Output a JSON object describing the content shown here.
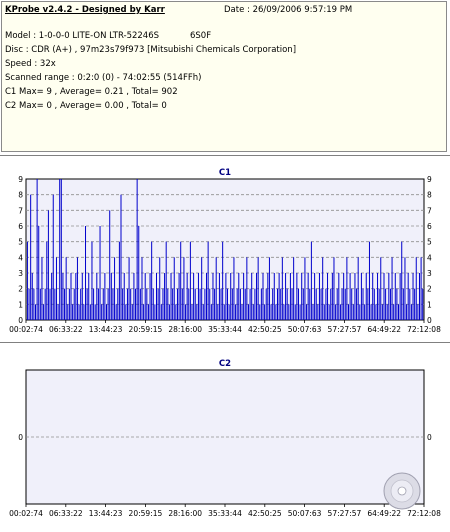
{
  "info": {
    "title": "KProbe v2.4.2 - Designed by Karr",
    "date": "Date : 26/09/2006 9:57:19 PM",
    "model": "Model : 1-0-0-0 LITE-ON LTR-52246S",
    "firmware": "6S0F",
    "disc": "Disc : CDR (A+) , 97m23s79f973 [Mitsubishi Chemicals Corporation]",
    "speed": "Speed : 32x",
    "range": "Scanned range : 0:2:0 (0) - 74:02:55 (514FFh)",
    "c1": "C1 Max= 9 , Average= 0.21 , Total= 902",
    "c2": "C2 Max= 0 , Average= 0.00 , Total= 0"
  },
  "chart_data": [
    {
      "type": "bar",
      "title": "C1",
      "ylim": [
        0,
        9
      ],
      "yticks": [
        "0",
        "1",
        "2",
        "3",
        "4",
        "5",
        "6",
        "7",
        "8",
        "9"
      ],
      "xticks": [
        "00:02:74",
        "06:33:22",
        "13:44:23",
        "20:59:15",
        "28:16:00",
        "35:33:44",
        "42:50:25",
        "50:07:63",
        "57:27:57",
        "64:49:22",
        "72:12:08"
      ],
      "xlim_minutes": [
        0.033,
        74.04
      ],
      "grid": true,
      "color": "#0000cc",
      "spikes": [
        [
          0.3,
          5
        ],
        [
          0.6,
          2
        ],
        [
          0.9,
          8
        ],
        [
          1.2,
          3
        ],
        [
          1.5,
          2
        ],
        [
          1.8,
          1
        ],
        [
          2.1,
          9
        ],
        [
          2.4,
          6
        ],
        [
          2.7,
          2
        ],
        [
          3.0,
          4
        ],
        [
          3.3,
          1
        ],
        [
          3.6,
          2
        ],
        [
          3.9,
          5
        ],
        [
          4.2,
          7
        ],
        [
          4.5,
          2
        ],
        [
          4.8,
          3
        ],
        [
          5.1,
          8
        ],
        [
          5.4,
          2
        ],
        [
          5.7,
          4
        ],
        [
          6.0,
          1
        ],
        [
          6.3,
          9
        ],
        [
          6.6,
          9
        ],
        [
          6.9,
          3
        ],
        [
          7.2,
          2
        ],
        [
          7.5,
          4
        ],
        [
          7.8,
          1
        ],
        [
          8.1,
          2
        ],
        [
          8.4,
          3
        ],
        [
          8.7,
          1
        ],
        [
          9.0,
          2
        ],
        [
          9.3,
          3
        ],
        [
          9.6,
          4
        ],
        [
          9.9,
          1
        ],
        [
          10.2,
          2
        ],
        [
          10.5,
          3
        ],
        [
          10.8,
          1
        ],
        [
          11.1,
          6
        ],
        [
          11.4,
          2
        ],
        [
          11.7,
          3
        ],
        [
          12.0,
          1
        ],
        [
          12.3,
          5
        ],
        [
          12.6,
          2
        ],
        [
          12.9,
          1
        ],
        [
          13.2,
          3
        ],
        [
          13.5,
          2
        ],
        [
          13.8,
          6
        ],
        [
          14.1,
          1
        ],
        [
          14.4,
          2
        ],
        [
          14.7,
          3
        ],
        [
          15.0,
          1
        ],
        [
          15.3,
          2
        ],
        [
          15.6,
          7
        ],
        [
          15.9,
          3
        ],
        [
          16.2,
          2
        ],
        [
          16.5,
          4
        ],
        [
          16.8,
          1
        ],
        [
          17.1,
          2
        ],
        [
          17.4,
          5
        ],
        [
          17.7,
          8
        ],
        [
          18.0,
          2
        ],
        [
          18.3,
          3
        ],
        [
          18.6,
          1
        ],
        [
          18.9,
          2
        ],
        [
          19.2,
          4
        ],
        [
          19.5,
          2
        ],
        [
          19.8,
          1
        ],
        [
          20.1,
          3
        ],
        [
          20.4,
          2
        ],
        [
          20.7,
          9
        ],
        [
          21.0,
          6
        ],
        [
          21.3,
          2
        ],
        [
          21.6,
          4
        ],
        [
          21.9,
          1
        ],
        [
          22.2,
          3
        ],
        [
          22.5,
          2
        ],
        [
          22.8,
          1
        ],
        [
          23.1,
          3
        ],
        [
          23.4,
          5
        ],
        [
          23.7,
          2
        ],
        [
          24.0,
          1
        ],
        [
          24.3,
          3
        ],
        [
          24.6,
          2
        ],
        [
          24.9,
          4
        ],
        [
          25.2,
          1
        ],
        [
          25.5,
          2
        ],
        [
          25.8,
          3
        ],
        [
          26.1,
          5
        ],
        [
          26.4,
          2
        ],
        [
          26.7,
          1
        ],
        [
          27.0,
          3
        ],
        [
          27.3,
          2
        ],
        [
          27.6,
          4
        ],
        [
          27.9,
          1
        ],
        [
          28.2,
          2
        ],
        [
          28.5,
          3
        ],
        [
          28.8,
          5
        ],
        [
          29.1,
          2
        ],
        [
          29.4,
          4
        ],
        [
          29.7,
          1
        ],
        [
          30.0,
          3
        ],
        [
          30.3,
          2
        ],
        [
          30.6,
          5
        ],
        [
          30.9,
          1
        ],
        [
          31.2,
          3
        ],
        [
          31.5,
          2
        ],
        [
          31.8,
          1
        ],
        [
          32.1,
          3
        ],
        [
          32.4,
          2
        ],
        [
          32.7,
          4
        ],
        [
          33.0,
          1
        ],
        [
          33.3,
          2
        ],
        [
          33.6,
          3
        ],
        [
          33.9,
          5
        ],
        [
          34.2,
          2
        ],
        [
          34.5,
          1
        ],
        [
          34.8,
          3
        ],
        [
          35.1,
          2
        ],
        [
          35.4,
          4
        ],
        [
          35.7,
          1
        ],
        [
          36.0,
          3
        ],
        [
          36.3,
          2
        ],
        [
          36.6,
          5
        ],
        [
          36.9,
          1
        ],
        [
          37.2,
          3
        ],
        [
          37.5,
          2
        ],
        [
          37.8,
          1
        ],
        [
          38.1,
          3
        ],
        [
          38.4,
          2
        ],
        [
          38.7,
          4
        ],
        [
          39.0,
          1
        ],
        [
          39.3,
          2
        ],
        [
          39.6,
          3
        ],
        [
          39.9,
          2
        ],
        [
          40.2,
          1
        ],
        [
          40.5,
          3
        ],
        [
          40.8,
          2
        ],
        [
          41.1,
          4
        ],
        [
          41.4,
          1
        ],
        [
          41.7,
          2
        ],
        [
          42.0,
          3
        ],
        [
          42.3,
          1
        ],
        [
          42.6,
          2
        ],
        [
          42.9,
          3
        ],
        [
          43.2,
          4
        ],
        [
          43.5,
          1
        ],
        [
          43.8,
          2
        ],
        [
          44.1,
          3
        ],
        [
          44.4,
          1
        ],
        [
          44.7,
          2
        ],
        [
          45.0,
          3
        ],
        [
          45.3,
          4
        ],
        [
          45.6,
          1
        ],
        [
          45.9,
          2
        ],
        [
          46.2,
          3
        ],
        [
          46.5,
          1
        ],
        [
          46.8,
          2
        ],
        [
          47.1,
          3
        ],
        [
          47.4,
          2
        ],
        [
          47.7,
          4
        ],
        [
          48.0,
          1
        ],
        [
          48.3,
          3
        ],
        [
          48.6,
          2
        ],
        [
          48.9,
          1
        ],
        [
          49.2,
          3
        ],
        [
          49.5,
          2
        ],
        [
          49.8,
          4
        ],
        [
          50.1,
          1
        ],
        [
          50.4,
          3
        ],
        [
          50.7,
          2
        ],
        [
          51.0,
          1
        ],
        [
          51.3,
          3
        ],
        [
          51.6,
          2
        ],
        [
          51.9,
          4
        ],
        [
          52.2,
          1
        ],
        [
          52.5,
          3
        ],
        [
          52.8,
          2
        ],
        [
          53.1,
          5
        ],
        [
          53.4,
          1
        ],
        [
          53.7,
          3
        ],
        [
          54.0,
          2
        ],
        [
          54.3,
          1
        ],
        [
          54.6,
          3
        ],
        [
          54.9,
          2
        ],
        [
          55.2,
          4
        ],
        [
          55.5,
          1
        ],
        [
          55.8,
          2
        ],
        [
          56.1,
          3
        ],
        [
          56.4,
          1
        ],
        [
          56.7,
          2
        ],
        [
          57.0,
          3
        ],
        [
          57.3,
          4
        ],
        [
          57.6,
          1
        ],
        [
          57.9,
          2
        ],
        [
          58.2,
          3
        ],
        [
          58.5,
          1
        ],
        [
          58.8,
          2
        ],
        [
          59.1,
          3
        ],
        [
          59.4,
          2
        ],
        [
          59.7,
          4
        ],
        [
          60.0,
          1
        ],
        [
          60.3,
          3
        ],
        [
          60.6,
          2
        ],
        [
          60.9,
          1
        ],
        [
          61.2,
          3
        ],
        [
          61.5,
          2
        ],
        [
          61.8,
          4
        ],
        [
          62.1,
          1
        ],
        [
          62.4,
          3
        ],
        [
          62.7,
          2
        ],
        [
          63.0,
          1
        ],
        [
          63.3,
          3
        ],
        [
          63.6,
          2
        ],
        [
          63.9,
          5
        ],
        [
          64.2,
          1
        ],
        [
          64.5,
          3
        ],
        [
          64.8,
          2
        ],
        [
          65.1,
          1
        ],
        [
          65.4,
          3
        ],
        [
          65.7,
          2
        ],
        [
          66.0,
          4
        ],
        [
          66.3,
          1
        ],
        [
          66.6,
          3
        ],
        [
          66.9,
          2
        ],
        [
          67.2,
          1
        ],
        [
          67.5,
          3
        ],
        [
          67.8,
          2
        ],
        [
          68.1,
          4
        ],
        [
          68.4,
          1
        ],
        [
          68.7,
          3
        ],
        [
          69.0,
          2
        ],
        [
          69.3,
          1
        ],
        [
          69.6,
          3
        ],
        [
          69.9,
          5
        ],
        [
          70.2,
          2
        ],
        [
          70.5,
          4
        ],
        [
          70.8,
          1
        ],
        [
          71.1,
          3
        ],
        [
          71.4,
          2
        ],
        [
          71.7,
          1
        ],
        [
          72.0,
          3
        ],
        [
          72.3,
          2
        ],
        [
          72.6,
          4
        ],
        [
          72.9,
          1
        ],
        [
          73.2,
          3
        ],
        [
          73.5,
          4
        ],
        [
          73.8,
          2
        ]
      ]
    },
    {
      "type": "bar",
      "title": "C2",
      "ylim": [
        0,
        1
      ],
      "yticks": [
        "0"
      ],
      "xticks": [
        "00:02:74",
        "06:33:22",
        "13:44:23",
        "20:59:15",
        "28:16:00",
        "35:33:44",
        "42:50:25",
        "50:07:63",
        "57:27:57",
        "64:49:22",
        "72:12:08"
      ],
      "grid": true,
      "color": "#0000cc",
      "spikes": []
    }
  ],
  "icons": {
    "disc": "cd-disc-icon"
  }
}
